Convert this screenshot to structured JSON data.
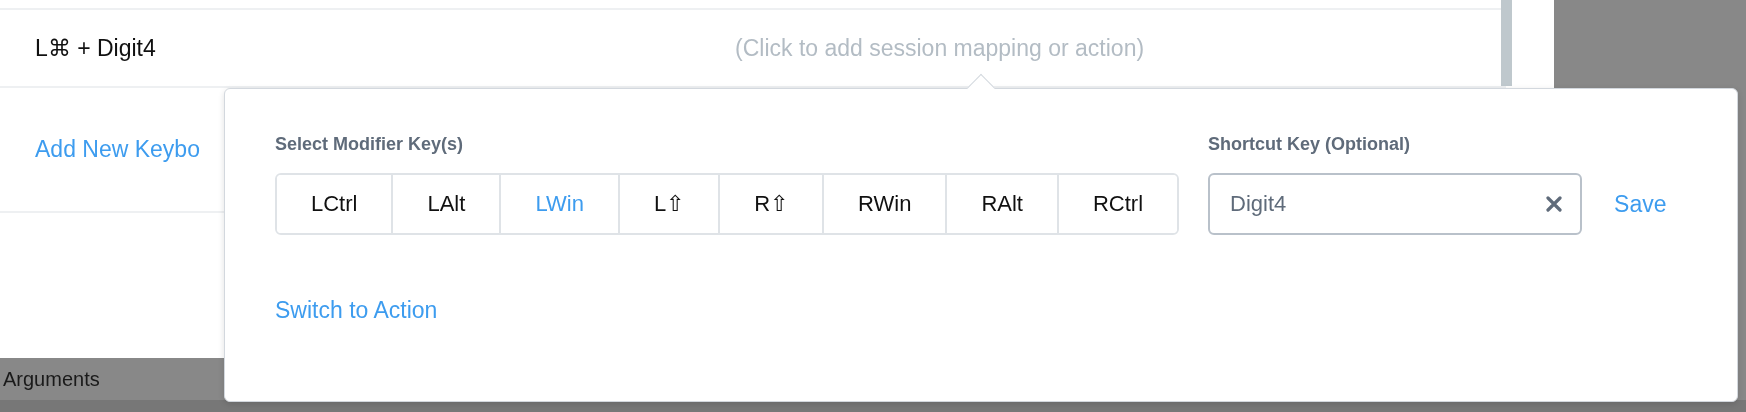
{
  "mappings": [
    {
      "keys": "L⌘ + Digit4",
      "hint": "(Click to add session mapping or action)"
    }
  ],
  "add_link": "Add New Keybo",
  "popover": {
    "modifier_label": "Select Modifier Key(s)",
    "modifiers": [
      {
        "label": "LCtrl",
        "selected": false
      },
      {
        "label": "LAlt",
        "selected": false
      },
      {
        "label": "LWin",
        "selected": true
      },
      {
        "label": "L⇧",
        "selected": false
      },
      {
        "label": "R⇧",
        "selected": false
      },
      {
        "label": "RWin",
        "selected": false
      },
      {
        "label": "RAlt",
        "selected": false
      },
      {
        "label": "RCtrl",
        "selected": false
      }
    ],
    "shortcut_label": "Shortcut Key (Optional)",
    "shortcut_value": "Digit4",
    "save": "Save",
    "switch_link": "Switch to Action"
  },
  "bottom_bar": {
    "label": "Arguments"
  }
}
